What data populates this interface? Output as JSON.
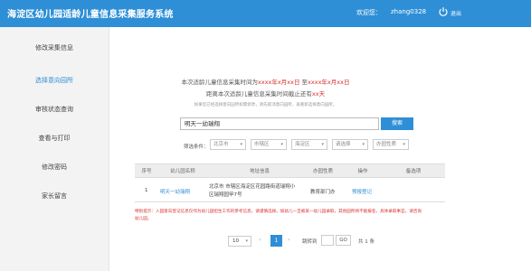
{
  "header": {
    "title": "海淀区幼儿园适龄儿童信息采集服务系统",
    "welcome_label": "欢迎您：",
    "username": "zhang0328",
    "power_icon": "power-icon",
    "logout_label": "退出"
  },
  "sidebar": {
    "items": [
      {
        "label": "修改采集信息",
        "active": false
      },
      {
        "label": "选择意向园所",
        "active": true
      },
      {
        "label": "审核状态查询",
        "active": false
      },
      {
        "label": "查看与打印",
        "active": false
      },
      {
        "label": "修改密码",
        "active": false
      },
      {
        "label": "家长留言",
        "active": false
      }
    ]
  },
  "notice": {
    "line1_prefix": "本次适龄儿童信息采集时间为",
    "line1_start": "xxxx年x月xx日",
    "line1_mid": " 至",
    "line1_end": "xxxx年x月xx日",
    "line2_prefix": "距离本次适龄儿童信息采集时间截止还有",
    "line2_days": "xx天",
    "hint": "如果您已经选择意向园所如需修改，请先取消意向园所，再重新选择意向园所。"
  },
  "search": {
    "value": "明天一幼瑞翔",
    "button_label": "搜索"
  },
  "filters": {
    "label": "筛选条件：",
    "selects": [
      "北京市",
      "市辖区",
      "海淀区",
      "请选择",
      "办园性质"
    ]
  },
  "table": {
    "headers": [
      "序号",
      "幼儿园名称",
      "地址信息",
      "办园性质",
      "操作",
      "备选项"
    ],
    "rows": [
      {
        "index": "1",
        "name": "明天一幼瑞翔",
        "address_line1": "北京市 市辖区海淀区花园路街道瑞翔小",
        "address_line2": "区瑞翔园甲7号",
        "type": "教育部门办",
        "action": "预报登记",
        "option": ""
      }
    ]
  },
  "warning": {
    "line1": "特别提示：入园意向登记信息仅作为幼儿园招生工作的参考信息，请谨慎选择。如幼儿一旦被某一幼儿园录取，其他园所将不能报名，具体录取事宜，请咨询",
    "line2": "幼儿园。"
  },
  "pagination": {
    "page_size": "10",
    "prev": "‹",
    "current_page": "1",
    "next": "›",
    "jump_label": "跳转到",
    "go_label": "GO",
    "total": "共 1 条"
  },
  "colors": {
    "header": "#2e8fd6",
    "accent": "#2e8fd6",
    "warning": "#d9302c"
  }
}
